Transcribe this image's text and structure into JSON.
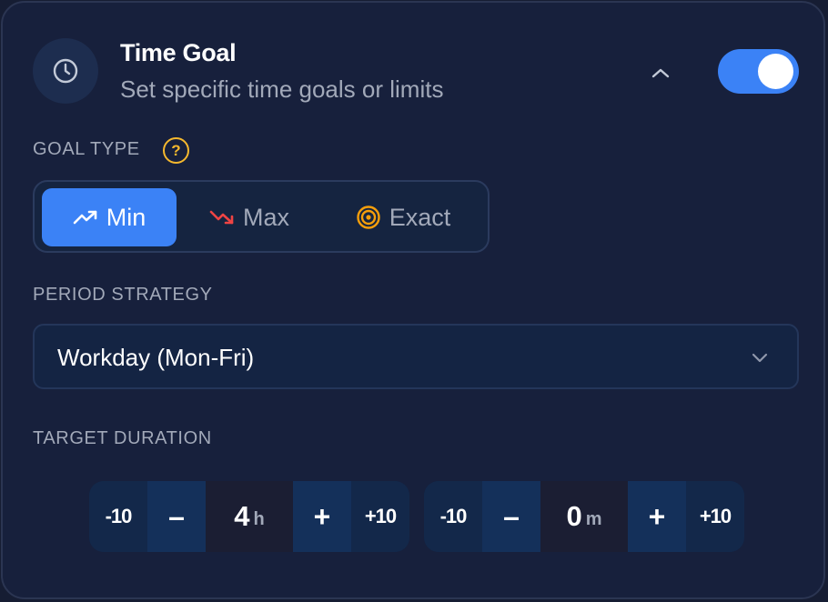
{
  "header": {
    "icon": "clock-icon",
    "title": "Time Goal",
    "subtitle": "Set specific time goals or limits",
    "collapse_icon": "chevron-up-icon",
    "enabled": true
  },
  "goal_type": {
    "label": "GOAL TYPE",
    "help_icon": "question-circle-icon",
    "help_glyph": "?",
    "options": [
      {
        "label": "Min",
        "icon": "trending-up-icon",
        "active": true
      },
      {
        "label": "Max",
        "icon": "trending-down-icon",
        "active": false
      },
      {
        "label": "Exact",
        "icon": "target-icon",
        "active": false
      }
    ]
  },
  "period": {
    "label": "PERIOD STRATEGY",
    "value": "Workday (Mon-Fri)",
    "dropdown_icon": "chevron-down-icon"
  },
  "target": {
    "label": "TARGET DURATION",
    "hours": {
      "dec10": "-10",
      "dec": "–",
      "value": "4",
      "unit": "h",
      "inc": "+",
      "inc10": "+10"
    },
    "minutes": {
      "dec10": "-10",
      "dec": "–",
      "value": "0",
      "unit": "m",
      "inc": "+",
      "inc10": "+10"
    }
  },
  "colors": {
    "accent": "#3b82f6",
    "card_bg": "#17203c",
    "warning": "#f5b82e",
    "danger": "#ef4444",
    "target_orange": "#f59e0b"
  }
}
